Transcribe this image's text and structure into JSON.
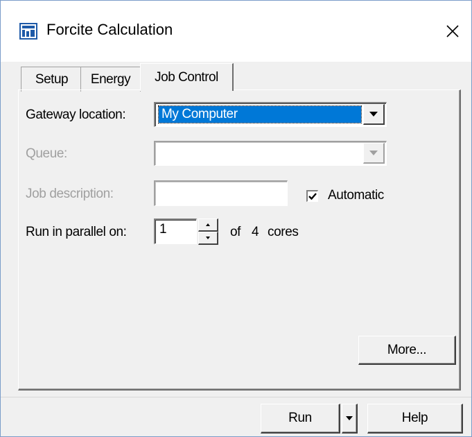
{
  "window": {
    "title": "Forcite Calculation"
  },
  "tabs": [
    {
      "label": "Setup",
      "active": false
    },
    {
      "label": "Energy",
      "active": false
    },
    {
      "label": "Job Control",
      "active": true
    }
  ],
  "job_control": {
    "gateway_label": "Gateway location:",
    "gateway_value": "My Computer",
    "queue_label": "Queue:",
    "queue_value": "",
    "job_description_label": "Job description:",
    "job_description_value": "",
    "automatic_label": "Automatic",
    "automatic_checked": true,
    "parallel_label": "Run in parallel on:",
    "parallel_value": "1",
    "of_label": "of",
    "cores_count": "4",
    "cores_label": "cores",
    "more_button": "More..."
  },
  "footer": {
    "run_button": "Run",
    "help_button": "Help"
  },
  "colors": {
    "selection": "#0078d7",
    "dialog_bg": "#f0f0f0",
    "disabled_text": "#a0a0a0",
    "window_border": "#7a9cc9"
  },
  "icons": {
    "app": "forcite-app-icon",
    "close": "close-icon",
    "dropdown": "chevron-down-icon",
    "spin_up": "spin-up-icon",
    "spin_down": "spin-down-icon",
    "check": "checkmark-icon"
  }
}
